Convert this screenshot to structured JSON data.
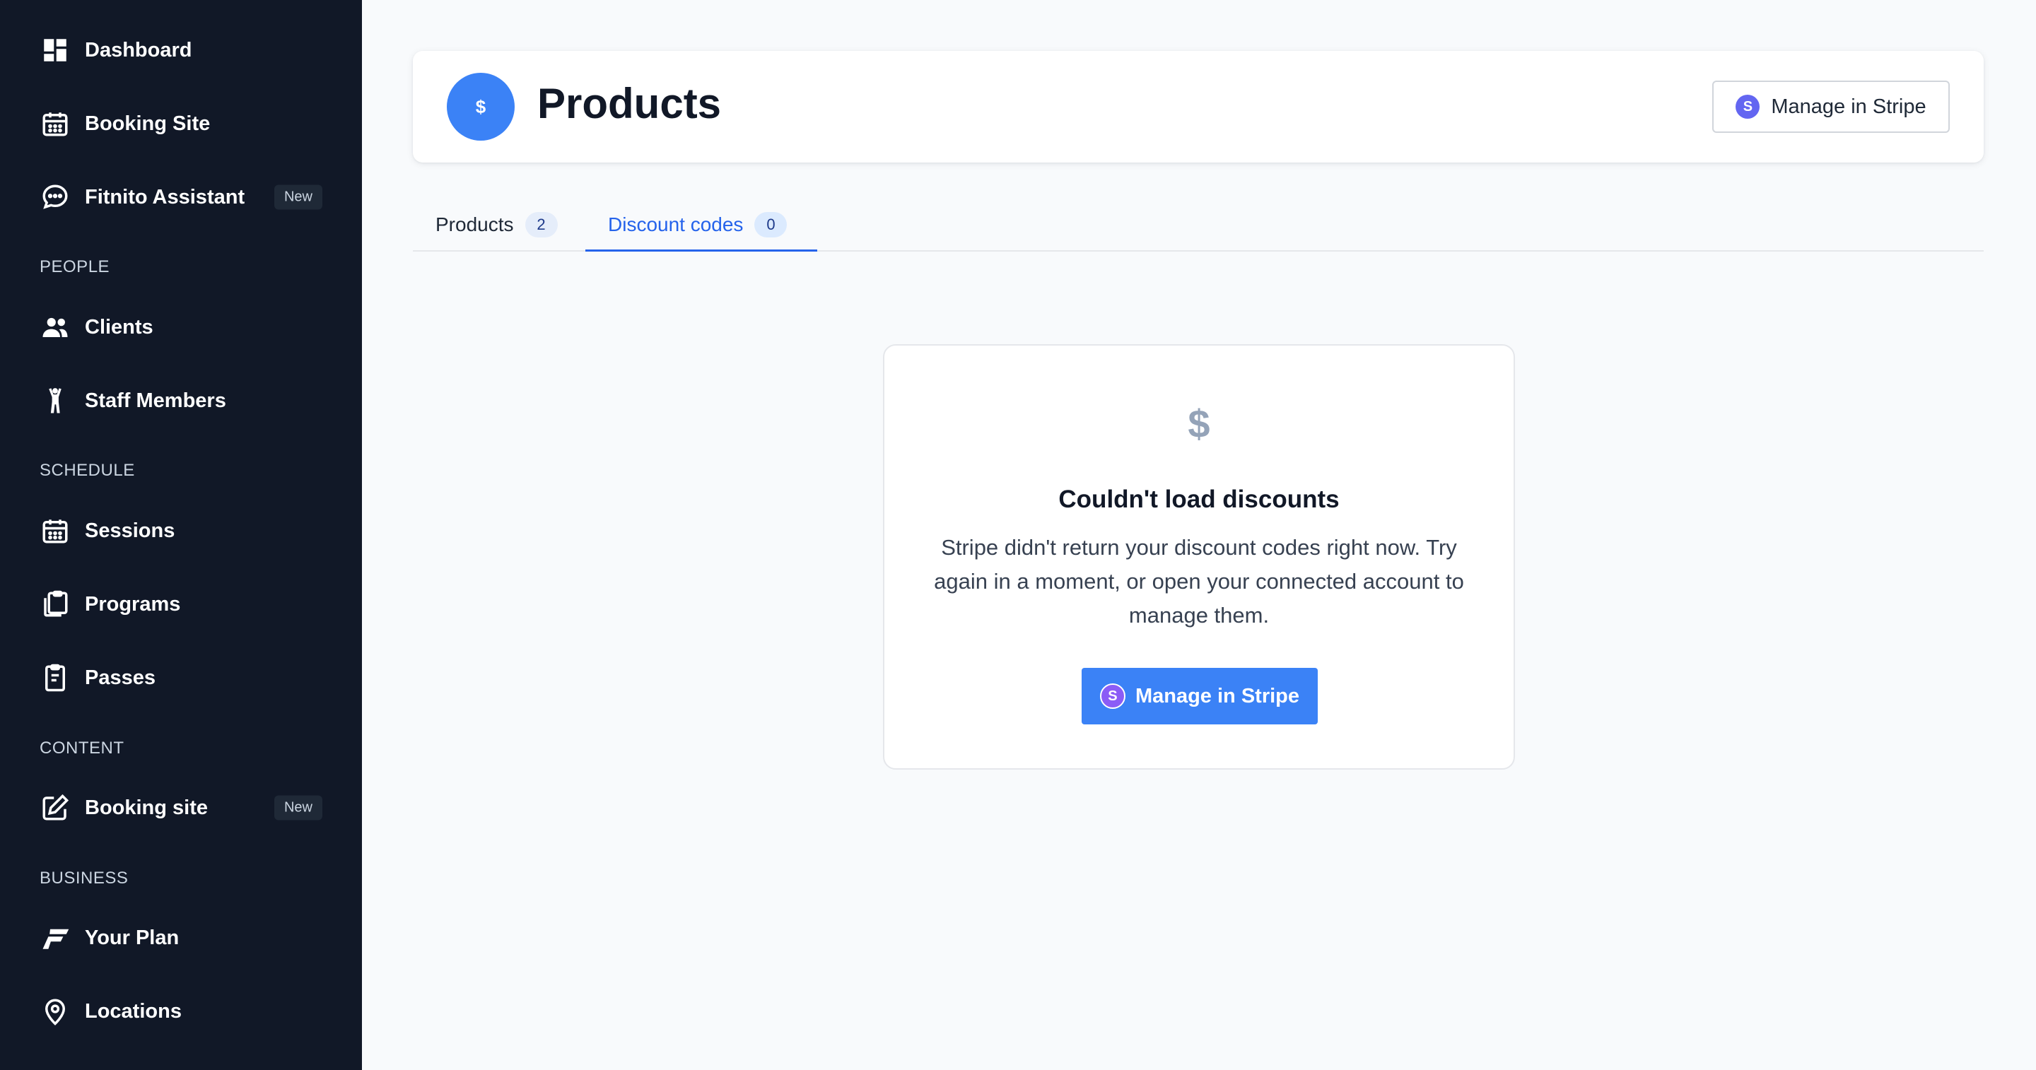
{
  "sidebar": {
    "items": [
      {
        "label": "Dashboard",
        "icon": "dashboard-icon"
      },
      {
        "label": "Booking Site",
        "icon": "calendar-icon"
      },
      {
        "label": "Fitnito Assistant",
        "icon": "chat-icon",
        "badge": "New"
      },
      {
        "label": "Clients",
        "icon": "users-icon"
      },
      {
        "label": "Staff Members",
        "icon": "person-icon"
      },
      {
        "label": "Sessions",
        "icon": "calendar-icon"
      },
      {
        "label": "Programs",
        "icon": "clipboard-stack-icon"
      },
      {
        "label": "Passes",
        "icon": "clipboard-icon"
      },
      {
        "label": "Booking site",
        "icon": "edit-icon",
        "badge": "New"
      },
      {
        "label": "Your Plan",
        "icon": "fitnito-logo-icon"
      },
      {
        "label": "Locations",
        "icon": "location-pin-icon"
      }
    ],
    "sections": {
      "people": "PEOPLE",
      "schedule": "SCHEDULE",
      "content": "CONTENT",
      "business": "BUSINESS"
    }
  },
  "header": {
    "avatar_symbol": "$",
    "title": "Products",
    "manage_label": "Manage in Stripe",
    "stripe_letter": "S"
  },
  "tabs": [
    {
      "label": "Products",
      "count": "2",
      "active": false
    },
    {
      "label": "Discount codes",
      "count": "0",
      "active": true
    }
  ],
  "empty_state": {
    "icon_symbol": "$",
    "title": "Couldn't load discounts",
    "message": "Stripe didn't return your discount codes right now. Try again in a moment, or open your connected account to manage them.",
    "button_label": "Manage in Stripe",
    "stripe_letter": "S"
  },
  "colors": {
    "sidebar_bg": "#111827",
    "accent": "#3b82f6",
    "tab_active": "#2563eb",
    "stripe": "#6366f1"
  }
}
